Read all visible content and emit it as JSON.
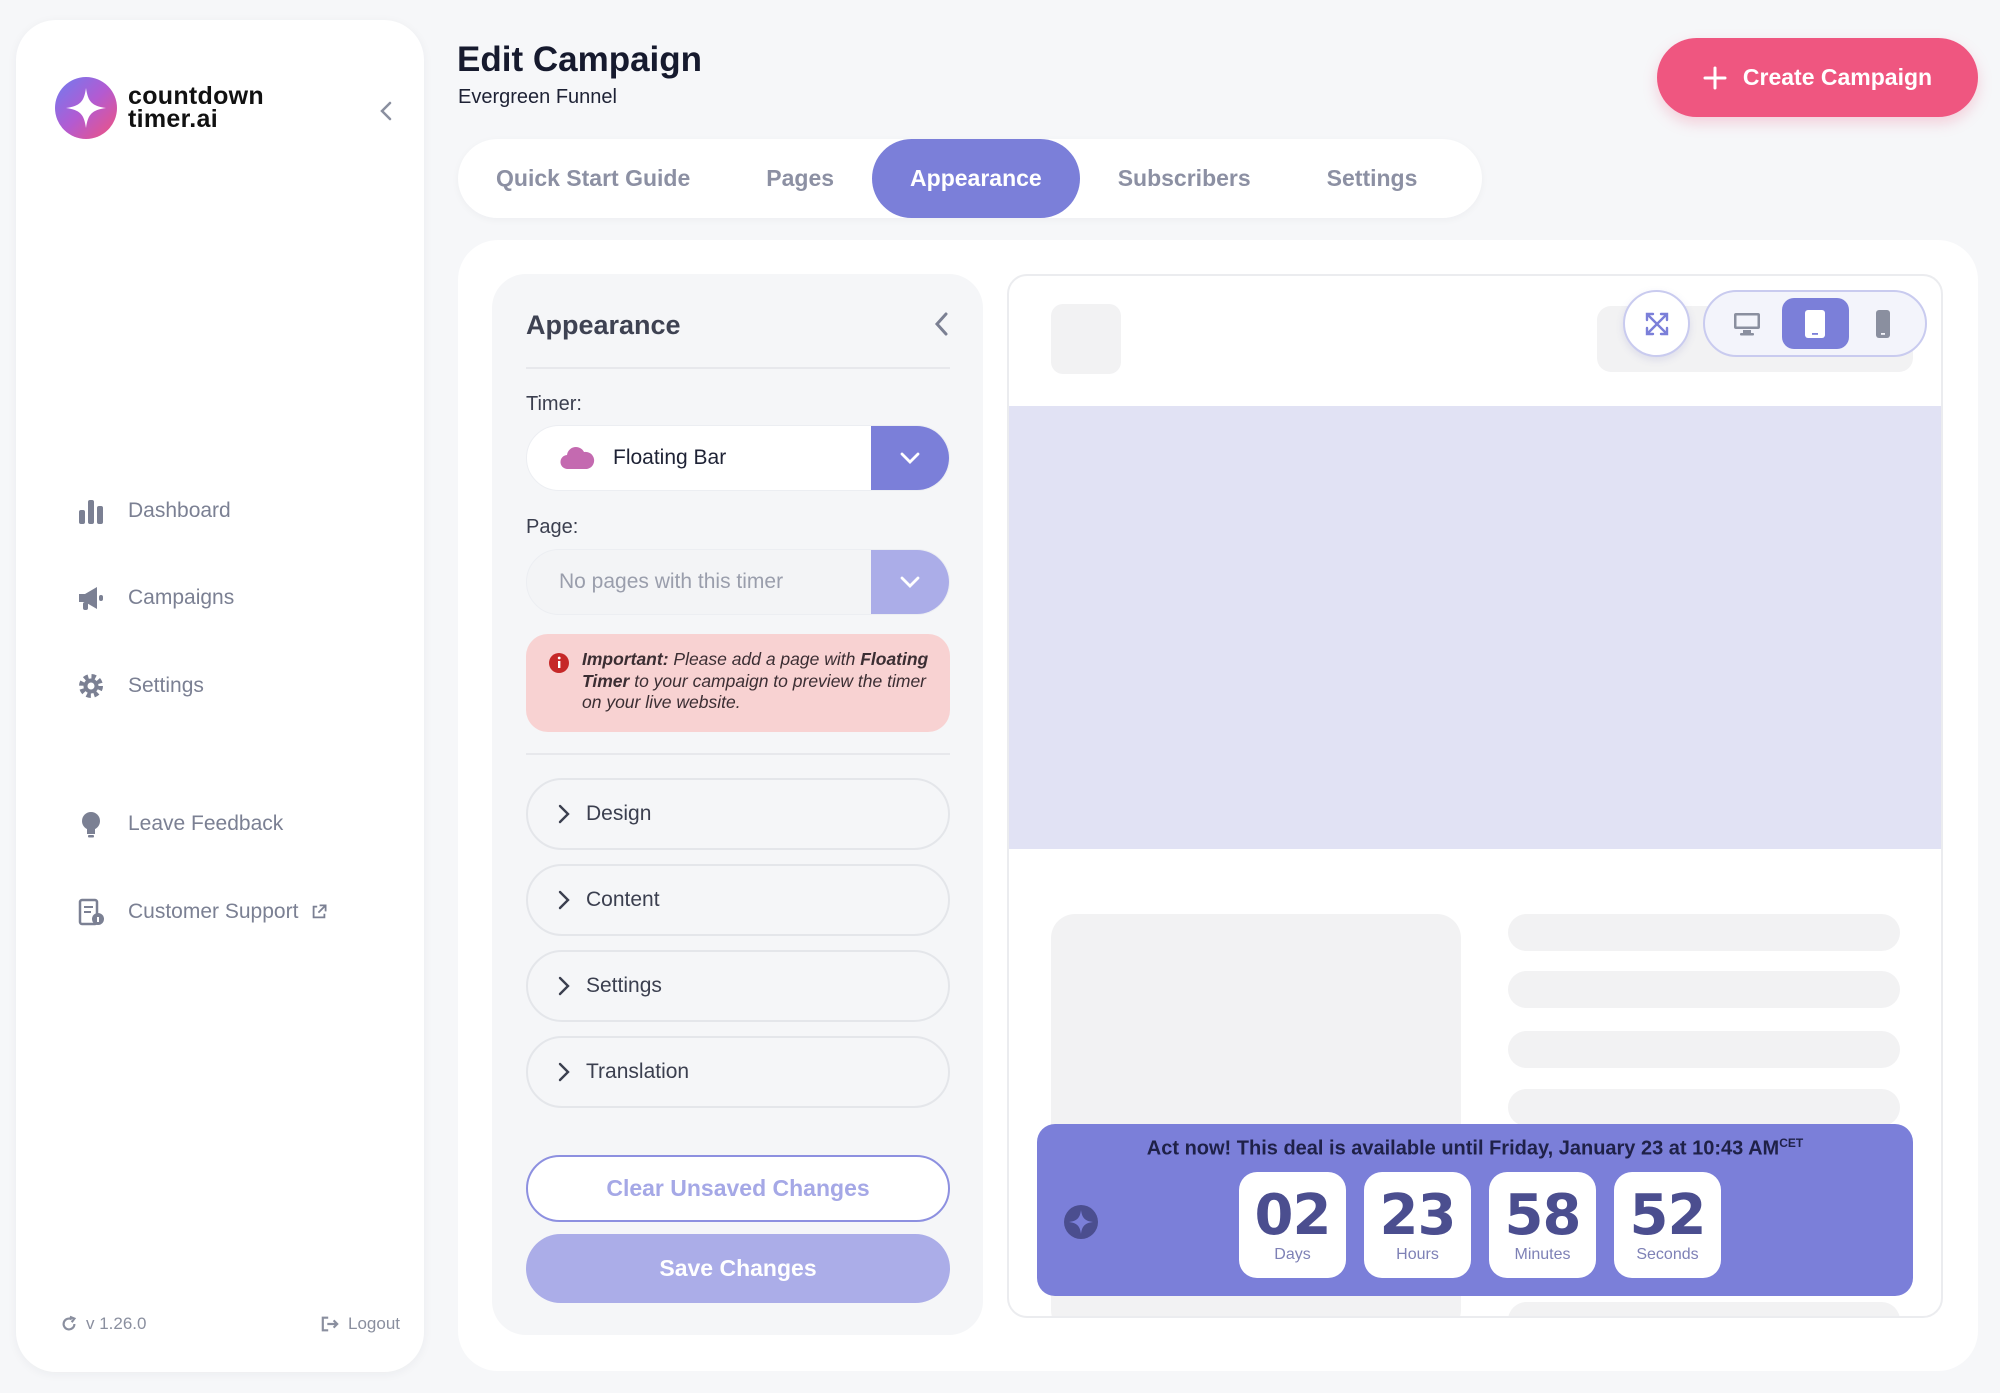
{
  "sidebar": {
    "logo_line1": "countdown",
    "logo_line2": "timer.ai",
    "nav": [
      {
        "label": "Dashboard",
        "icon": "chart-bar-icon"
      },
      {
        "label": "Campaigns",
        "icon": "megaphone-icon"
      },
      {
        "label": "Settings",
        "icon": "gear-icon"
      },
      {
        "label": "Leave Feedback",
        "icon": "lightbulb-icon"
      },
      {
        "label": "Customer Support",
        "icon": "document-info-icon"
      }
    ],
    "version": "v 1.26.0",
    "logout": "Logout"
  },
  "header": {
    "title": "Edit Campaign",
    "subtitle": "Evergreen Funnel",
    "create_button": "Create Campaign"
  },
  "tabs": [
    {
      "label": "Quick Start Guide",
      "active": false
    },
    {
      "label": "Pages",
      "active": false
    },
    {
      "label": "Appearance",
      "active": true
    },
    {
      "label": "Subscribers",
      "active": false
    },
    {
      "label": "Settings",
      "active": false
    }
  ],
  "panel": {
    "title": "Appearance",
    "timer_label": "Timer:",
    "timer_value": "Floating Bar",
    "page_label": "Page:",
    "page_placeholder": "No pages with this timer",
    "alert": {
      "strong1": "Important:",
      "text1": " Please add a page with ",
      "strong2": "Floating Timer",
      "text2": " to your campaign to preview the timer on your live website."
    },
    "sections": [
      "Design",
      "Content",
      "Settings",
      "Translation"
    ],
    "clear_button": "Clear Unsaved Changes",
    "save_button": "Save Changes"
  },
  "preview": {
    "device": "tablet",
    "timer_message": "Act now! This deal is available until Friday, January 23 at 10:43 AM",
    "timezone": "CET",
    "countdown": [
      {
        "value": "02",
        "label": "Days"
      },
      {
        "value": "23",
        "label": "Hours"
      },
      {
        "value": "58",
        "label": "Minutes"
      },
      {
        "value": "52",
        "label": "Seconds"
      }
    ]
  },
  "colors": {
    "accent": "#7b7fd9",
    "brand_pink": "#ef5680",
    "alert_bg": "#f8d2d2",
    "hero_bg": "#e1e2f4"
  }
}
